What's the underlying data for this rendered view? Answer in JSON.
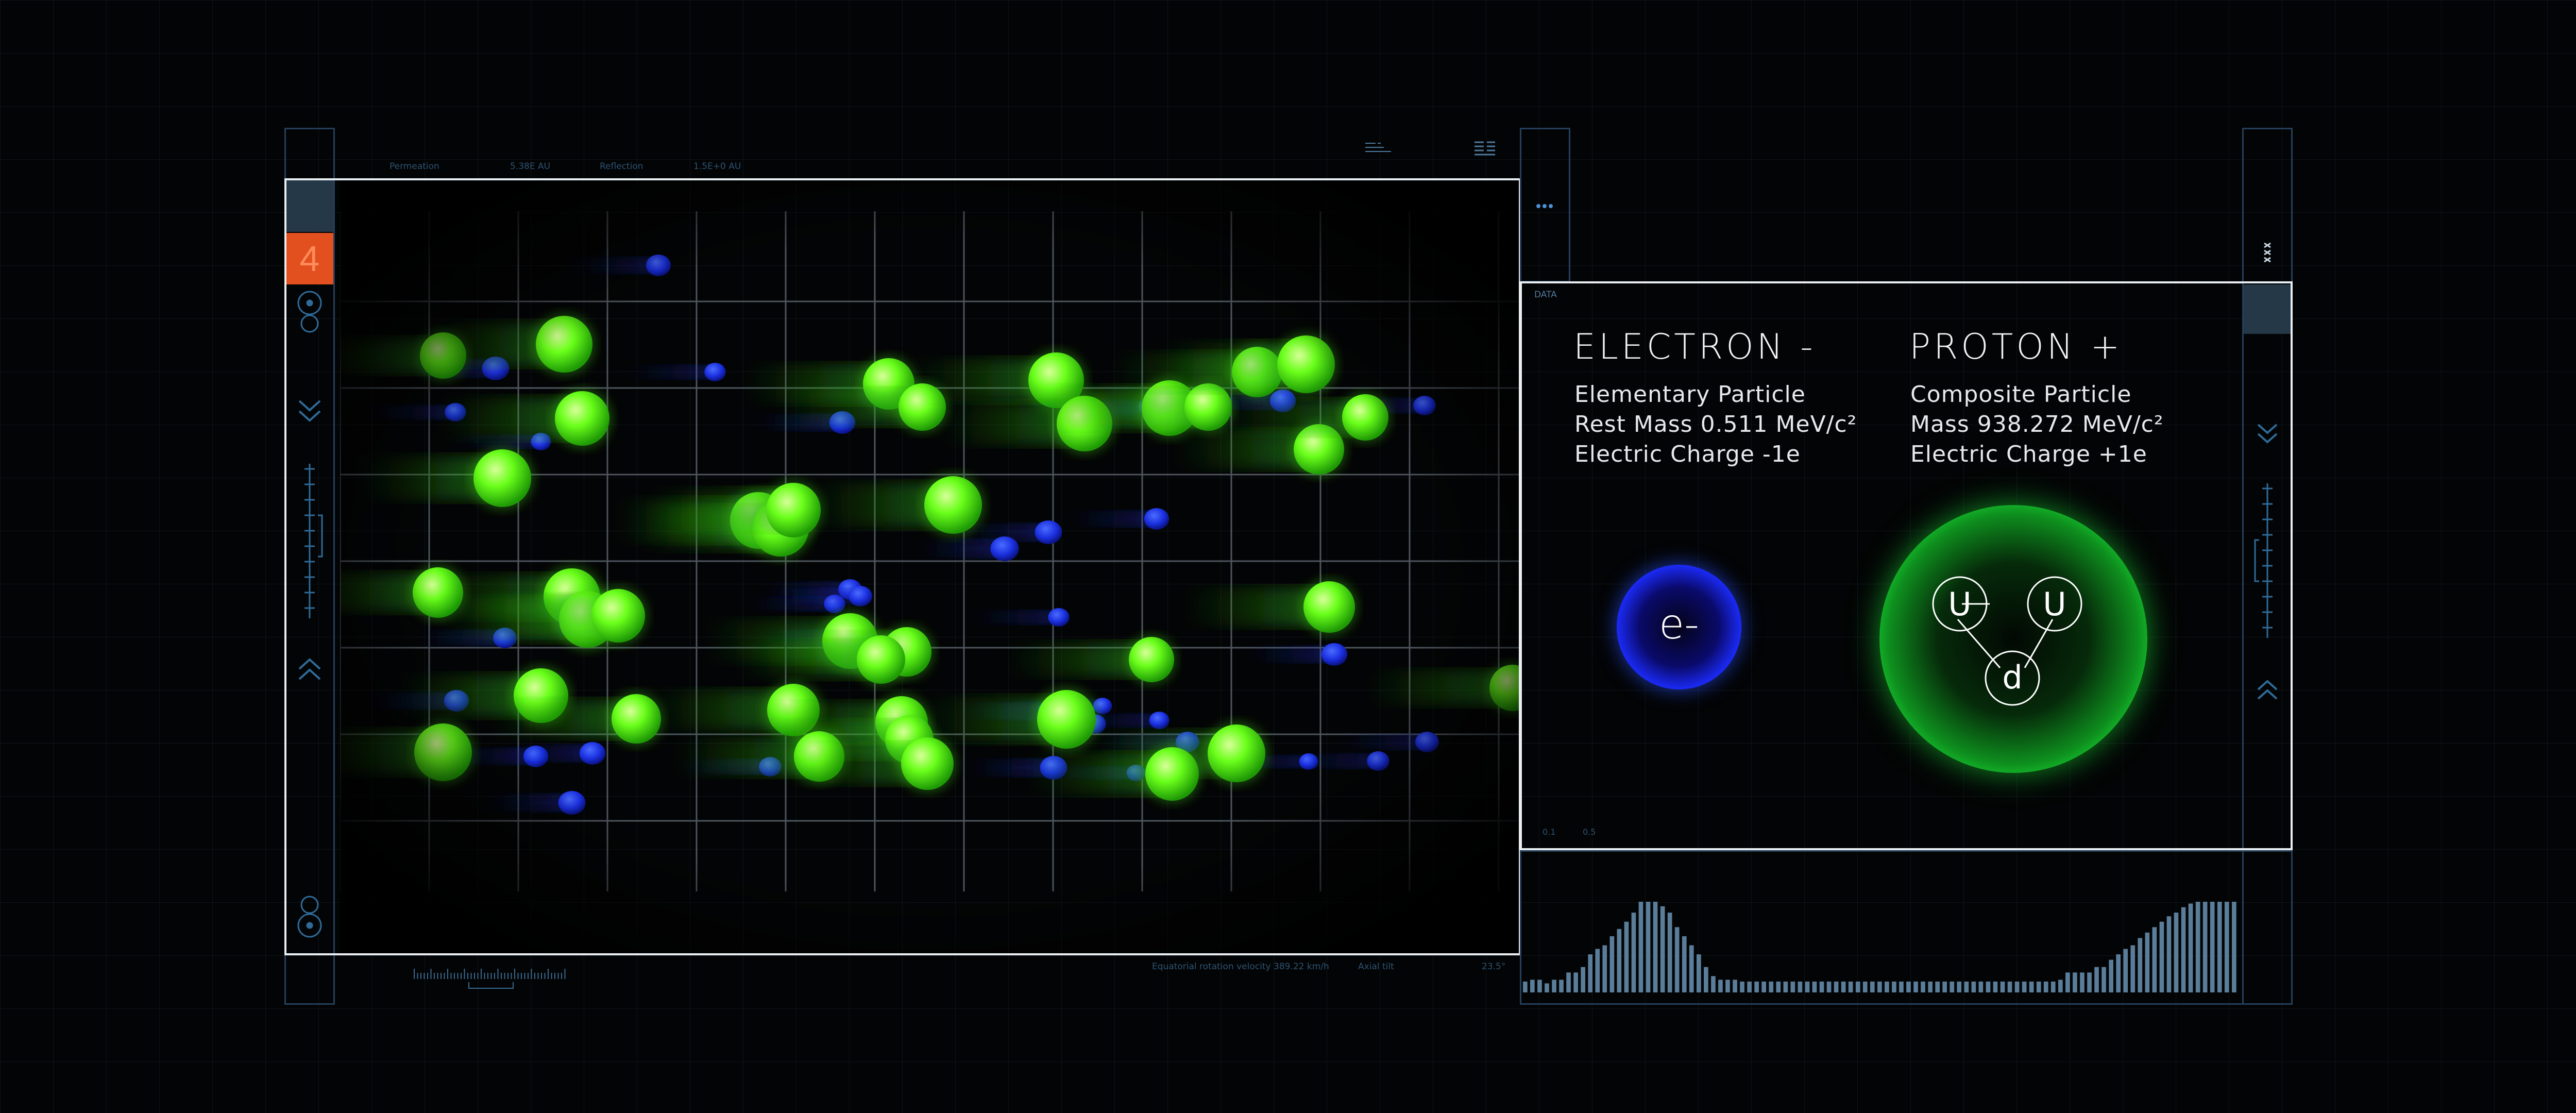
{
  "sidebar": {
    "counter": "4",
    "icons": [
      "target-icon",
      "chevron-down-double-icon",
      "scale-slider-icon",
      "chevron-up-double-icon",
      "target-icon"
    ]
  },
  "sim_header": {
    "labels": [
      "Permeation",
      "5.38E AU",
      "Reflection",
      "1.5E+0 AU"
    ]
  },
  "sim_footer": {
    "labels": [
      "Equatorial rotation velocity",
      "389.22 km/h",
      "Axial tilt",
      "23.5°"
    ]
  },
  "data_panel": {
    "tab_label": "DATA",
    "electron": {
      "title": "ELECTRON -",
      "lines": [
        "Elementary Particle",
        "Rest Mass 0.511 MeV/c²",
        "Electric Charge -1e"
      ],
      "symbol": "e-"
    },
    "proton": {
      "title": "PROTON +",
      "lines": [
        "Composite Particle",
        "Mass 938.272 MeV/c²",
        "Electric Charge +1e"
      ],
      "quarks": [
        "U",
        "U",
        "d"
      ]
    },
    "axis_ticks": [
      "0.1",
      "0.5"
    ]
  },
  "colors": {
    "proton_green": "#56ff1c",
    "electron_blue": "#1b3bff",
    "frame_white": "#e8eef2",
    "panel_blue": "#253f5a",
    "accent_orange": "#e2501f",
    "bar_blue": "#5a7d99"
  },
  "histogram": {
    "values": [
      12,
      14,
      14,
      10,
      14,
      14,
      22,
      22,
      28,
      42,
      48,
      52,
      62,
      70,
      78,
      88,
      100,
      100,
      100,
      95,
      88,
      72,
      62,
      52,
      42,
      28,
      18,
      14,
      14,
      14,
      12,
      12,
      12,
      12,
      12,
      12,
      12,
      12,
      12,
      12,
      12,
      12,
      12,
      12,
      12,
      12,
      12,
      12,
      12,
      12,
      12,
      12,
      12,
      12,
      12,
      12,
      12,
      12,
      12,
      12,
      12,
      12,
      12,
      12,
      12,
      12,
      12,
      12,
      12,
      12,
      12,
      12,
      12,
      12,
      14,
      22,
      22,
      22,
      22,
      28,
      28,
      36,
      42,
      48,
      52,
      60,
      66,
      72,
      78,
      84,
      88,
      94,
      98,
      100,
      100,
      100,
      100,
      100,
      100
    ]
  }
}
